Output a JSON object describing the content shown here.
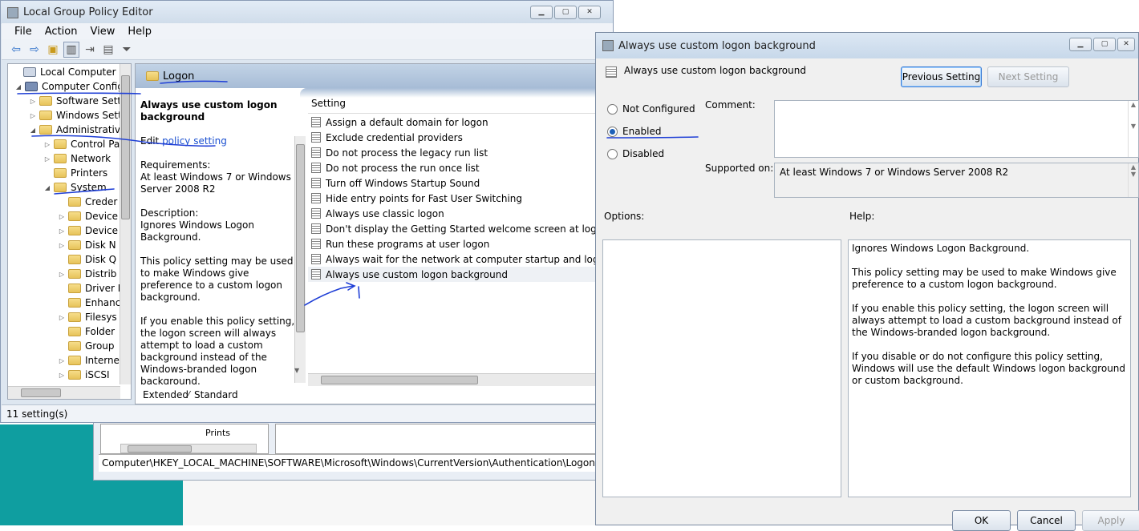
{
  "gpedit": {
    "title": "Local Group Policy Editor",
    "menu": [
      "File",
      "Action",
      "View",
      "Help"
    ],
    "tree": [
      {
        "label": "Local Computer Polic",
        "level": 0,
        "arrow": ""
      },
      {
        "label": "Computer Config",
        "level": 1,
        "arrow": "◢"
      },
      {
        "label": "Software Setti",
        "level": 2,
        "arrow": "▷"
      },
      {
        "label": "Windows Sett",
        "level": 2,
        "arrow": "▷"
      },
      {
        "label": "Administrative",
        "level": 2,
        "arrow": "◢"
      },
      {
        "label": "Control Pa",
        "level": 3,
        "arrow": "▷"
      },
      {
        "label": "Network",
        "level": 3,
        "arrow": "▷"
      },
      {
        "label": "Printers",
        "level": 3,
        "arrow": ""
      },
      {
        "label": "System",
        "level": 3,
        "arrow": "◢"
      },
      {
        "label": "Creder",
        "level": 4,
        "arrow": ""
      },
      {
        "label": "Device",
        "level": 4,
        "arrow": "▷"
      },
      {
        "label": "Device",
        "level": 4,
        "arrow": "▷"
      },
      {
        "label": "Disk N",
        "level": 4,
        "arrow": "▷"
      },
      {
        "label": "Disk Q",
        "level": 4,
        "arrow": ""
      },
      {
        "label": "Distrib",
        "level": 4,
        "arrow": "▷"
      },
      {
        "label": "Driver I",
        "level": 4,
        "arrow": ""
      },
      {
        "label": "Enhanc",
        "level": 4,
        "arrow": ""
      },
      {
        "label": "Filesys",
        "level": 4,
        "arrow": "▷"
      },
      {
        "label": "Folder",
        "level": 4,
        "arrow": ""
      },
      {
        "label": "Group",
        "level": 4,
        "arrow": ""
      },
      {
        "label": "Interne",
        "level": 4,
        "arrow": "▷"
      },
      {
        "label": "iSCSI",
        "level": 4,
        "arrow": "▷"
      }
    ],
    "folder_header": "Logon",
    "desc_title": "Always use custom logon background",
    "desc_edit_prefix": "Edit ",
    "desc_edit_link": "policy setting",
    "desc_req_label": "Requirements:",
    "desc_req": "At least Windows 7 or Windows Server 2008 R2",
    "desc_label": "Description:",
    "desc_text1": "Ignores Windows Logon Background.",
    "desc_text2": "This policy setting may be used to make Windows give preference to a custom logon background.",
    "desc_text3": "If you enable this policy setting, the logon screen will always attempt to load a custom background instead of the Windows-branded logon background.",
    "list_header": "Setting",
    "settings": [
      "Assign a default domain for logon",
      "Exclude credential providers",
      "Do not process the legacy run list",
      "Do not process the run once list",
      "Turn off Windows Startup Sound",
      "Hide entry points for Fast User Switching",
      "Always use classic logon",
      "Don't display the Getting Started welcome screen at logon",
      "Run these programs at user logon",
      "Always wait for the network at computer startup and logon",
      "Always use custom logon background"
    ],
    "selected_index": 10,
    "tab_extended": "Extended",
    "tab_standard": "Standard",
    "status": "11 setting(s)"
  },
  "regedit": {
    "status_path": "Computer\\HKEY_LOCAL_MACHINE\\SOFTWARE\\Microsoft\\Windows\\CurrentVersion\\Authentication\\LogonUI\\Background",
    "tree_partial": "Prints"
  },
  "dialog": {
    "title": "Always use custom logon background",
    "heading": "Always use custom logon background",
    "prev_button": "Previous Setting",
    "next_button": "Next Setting",
    "radio_not_configured": "Not Configured",
    "radio_enabled": "Enabled",
    "radio_disabled": "Disabled",
    "selected_radio": "Enabled",
    "comment_label": "Comment:",
    "supported_label": "Supported on:",
    "supported_value": "At least Windows 7 or Windows Server 2008 R2",
    "options_label": "Options:",
    "help_label": "Help:",
    "help1": "Ignores Windows Logon Background.",
    "help2": "This policy setting may be used to make Windows give preference to a custom logon background.",
    "help3": "If you enable this policy setting, the logon screen will always attempt to load a custom background instead of the Windows-branded logon background.",
    "help4": "If you disable or do not configure this policy setting, Windows will use the default Windows logon background or custom background.",
    "ok_button": "OK",
    "cancel_button": "Cancel",
    "apply_button": "Apply"
  },
  "colors": {
    "annotation_ink": "#1f3fd6",
    "desktop": "#0f9ea0",
    "link": "#1a4fd0"
  }
}
